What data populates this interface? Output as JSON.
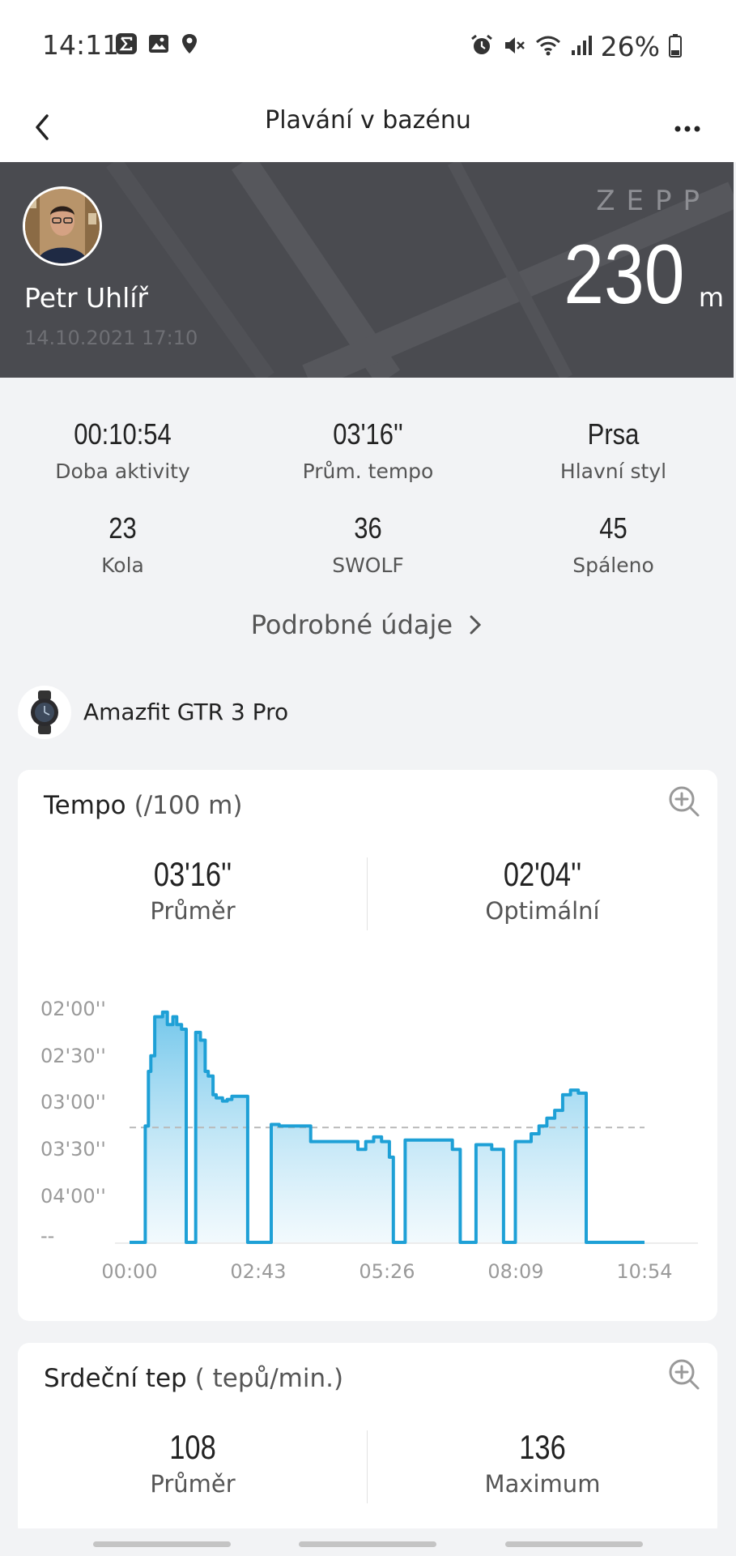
{
  "status_bar": {
    "time": "14:11",
    "battery": "26%",
    "left_icons": [
      "sigma-icon",
      "gallery-icon",
      "location-icon"
    ],
    "right_icons": [
      "alarm-icon",
      "mute-icon",
      "wifi-icon",
      "signal-icon",
      "battery-icon"
    ]
  },
  "app_bar": {
    "title": "Plavání v bazénu",
    "back_icon": "chevron-left-icon",
    "more_icon": "more-icon"
  },
  "header": {
    "user_name": "Petr Uhlíř",
    "date": "14.10.2021 17:10",
    "brand": "ZEPP",
    "distance": "230",
    "distance_unit": "m"
  },
  "stats": [
    {
      "value": "00:10:54",
      "label": "Doba aktivity"
    },
    {
      "value": "03'16''",
      "label": "Prům. tempo"
    },
    {
      "value": "Prsa",
      "label": "Hlavní styl"
    },
    {
      "value": "23",
      "label": "Kola"
    },
    {
      "value": "36",
      "label": "SWOLF"
    },
    {
      "value": "45",
      "label": "Spáleno"
    }
  ],
  "details_link": "Podrobné údaje",
  "device": {
    "name": "Amazfit GTR 3 Pro"
  },
  "tempo_card": {
    "title": "Tempo",
    "unit": "(/100 m)",
    "avg_value": "03'16''",
    "avg_label": "Průměr",
    "best_value": "02'04''",
    "best_label": "Optimální"
  },
  "chart_data": {
    "type": "area",
    "title": "Tempo",
    "ylabel": "(/100 m)",
    "y_ticks": [
      "02'00''",
      "02'30''",
      "03'00''",
      "03'30''",
      "04'00''",
      "--"
    ],
    "x_ticks": [
      "00:00",
      "02:43",
      "05:26",
      "08:09",
      "10:54"
    ],
    "y_unit": "seconds per 100 m",
    "y_inverted": true,
    "average_line": 196,
    "x": [
      0,
      15,
      18,
      20,
      24,
      27,
      32,
      36,
      42,
      48,
      55,
      60,
      66,
      72,
      78,
      84,
      90,
      96,
      100,
      106,
      110,
      118,
      124,
      130,
      138,
      145,
      150,
      160,
      170,
      180,
      190,
      195,
      200,
      205,
      215,
      225,
      230,
      240,
      250,
      260,
      270,
      280,
      290,
      300,
      310,
      320,
      330,
      335,
      340,
      350,
      360,
      370,
      380,
      390,
      400,
      410,
      420,
      430,
      440,
      450,
      460,
      470,
      475,
      480,
      490,
      500,
      510,
      520,
      530,
      540,
      550,
      560,
      570,
      580,
      590,
      600,
      610,
      620,
      630,
      640,
      645,
      650,
      654
    ],
    "y": [
      null,
      null,
      null,
      195,
      160,
      150,
      125,
      125,
      122,
      130,
      125,
      130,
      133,
      null,
      null,
      135,
      140,
      160,
      163,
      175,
      177,
      179,
      178,
      176,
      176,
      176,
      null,
      null,
      null,
      194,
      195,
      195,
      195,
      195,
      195,
      195,
      205,
      205,
      205,
      205,
      205,
      205,
      210,
      205,
      202,
      205,
      215,
      null,
      null,
      204,
      204,
      204,
      204,
      204,
      204,
      210,
      null,
      null,
      207,
      207,
      210,
      210,
      null,
      null,
      205,
      205,
      200,
      195,
      190,
      185,
      175,
      172,
      174,
      null,
      null,
      null,
      null,
      null,
      null,
      null,
      null,
      null,
      null
    ],
    "series": [
      {
        "name": "",
        "color": "#1ea0d6"
      }
    ],
    "grid": false
  },
  "hr_card": {
    "title": "Srdeční tep",
    "unit": "( tepů/min.)",
    "avg_value": "108",
    "avg_label": "Průměr",
    "max_value": "136",
    "max_label": "Maximum"
  },
  "colors": {
    "accent": "#1ea0d6",
    "banner": "#4a4b50",
    "background": "#f2f3f5"
  }
}
